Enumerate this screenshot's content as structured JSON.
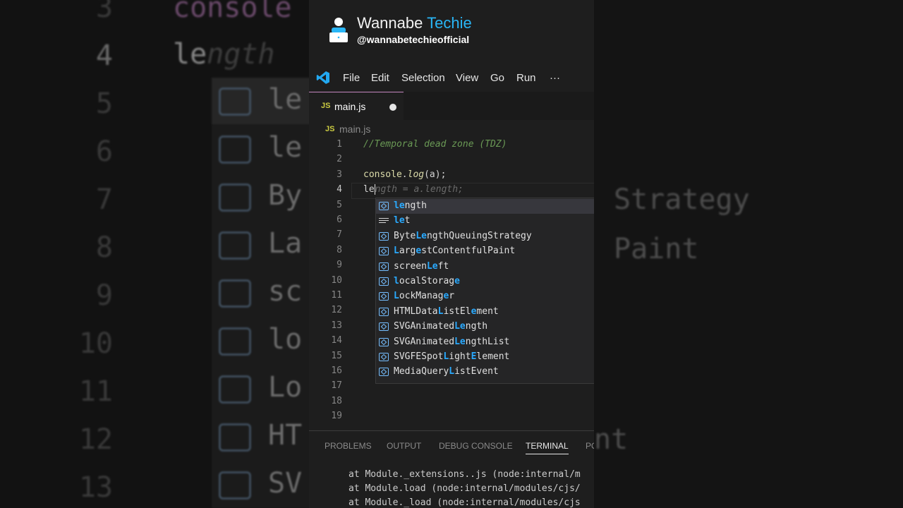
{
  "brand": {
    "name_part1": "Wannabe",
    "name_part2": "Techie",
    "handle": "@wannabetechieofficial"
  },
  "menu": {
    "items": [
      "File",
      "Edit",
      "Selection",
      "View",
      "Go",
      "Run",
      "···"
    ]
  },
  "tab": {
    "lang": "JS",
    "filename": "main.js"
  },
  "breadcrumb": {
    "lang": "JS",
    "filename": "main.js"
  },
  "editor": {
    "line_numbers": [
      "1",
      "2",
      "3",
      "4",
      "5",
      "6",
      "7",
      "8",
      "9",
      "10",
      "11",
      "12",
      "13",
      "14",
      "15",
      "16",
      "17",
      "18",
      "19"
    ],
    "active_line": "4",
    "comment": "//Temporal dead zone (TDZ)",
    "line3": {
      "obj": "console",
      "dot": ".",
      "fn": "log",
      "args": "(a);"
    },
    "line4": {
      "typed": "le",
      "ghost": "ngth = a.length;"
    }
  },
  "suggestions": [
    {
      "icon": "variable-icon",
      "pre": "",
      "hl": "le",
      "post": "ngth",
      "selected": true
    },
    {
      "icon": "keyword-icon",
      "pre": "",
      "hl": "le",
      "post": "t"
    },
    {
      "icon": "variable-icon",
      "pre": "Byte",
      "hl": "Le",
      "post": "ngthQueuingStrategy"
    },
    {
      "icon": "variable-icon",
      "pre": "",
      "hl": "L",
      "post": "arg",
      "hl2": "e",
      "post2": "stContentfulPaint"
    },
    {
      "icon": "variable-icon",
      "pre": "screen",
      "hl": "Le",
      "post": "ft"
    },
    {
      "icon": "variable-icon",
      "pre": "",
      "hl": "l",
      "post": "ocalStorag",
      "hl2": "e",
      "post2": ""
    },
    {
      "icon": "variable-icon",
      "pre": "",
      "hl": "L",
      "post": "ockManag",
      "hl2": "e",
      "post2": "r"
    },
    {
      "icon": "variable-icon",
      "pre": "HTMLData",
      "hl": "L",
      "post": "istEl",
      "hl2": "e",
      "post2": "ment"
    },
    {
      "icon": "variable-icon",
      "pre": "SVGAnimated",
      "hl": "Le",
      "post": "ngth"
    },
    {
      "icon": "variable-icon",
      "pre": "SVGAnimated",
      "hl": "Le",
      "post": "ngthList"
    },
    {
      "icon": "variable-icon",
      "pre": "SVGFESpot",
      "hl": "L",
      "post": "ight",
      "hl2": "E",
      "post2": "lement"
    },
    {
      "icon": "variable-icon",
      "pre": "MediaQuery",
      "hl": "L",
      "post": "istEvent"
    }
  ],
  "panel": {
    "tabs": [
      "PROBLEMS",
      "OUTPUT",
      "DEBUG CONSOLE",
      "TERMINAL",
      "PO"
    ],
    "active_tab": "TERMINAL",
    "terminal_lines": [
      "at Module._extensions..js (node:internal/m",
      "at Module.load (node:internal/modules/cjs/",
      "at Module._load (node:internal/modules/cjs"
    ]
  },
  "background": {
    "line_numbers": [
      "3",
      "4",
      "5",
      "6",
      "7",
      "8",
      "9",
      "10",
      "11",
      "12",
      "13"
    ],
    "code_top": "console",
    "code_line": "le",
    "code_ghost": "ngth",
    "suggest_labels": [
      "le",
      "le",
      "By",
      "La",
      "sc",
      "lo",
      "Lo",
      "HT",
      "SV"
    ],
    "right_labels": [
      "Strategy",
      "Paint",
      "nt"
    ]
  }
}
